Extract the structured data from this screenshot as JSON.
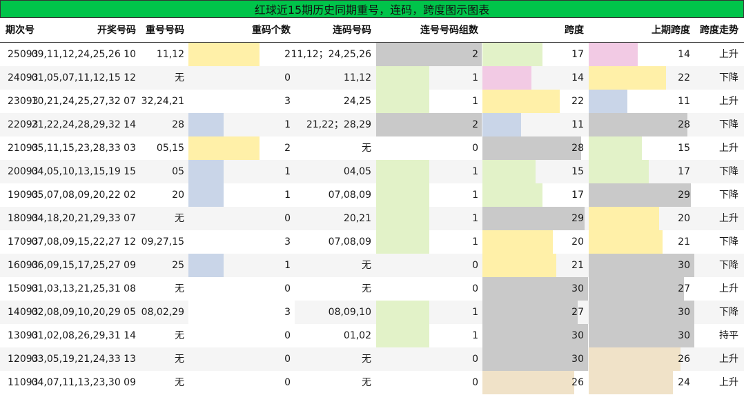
{
  "title": "红球近15期历史同期重号，连码，跨度图示图表",
  "headers": {
    "period": "期次号",
    "draw": "开奖号码",
    "repeat_nums": "重号号码",
    "repeat_count": "重码个数",
    "consec_nums": "连码号码",
    "consec_groups": "连号号码组数",
    "span": "跨度",
    "prev_span": "上期跨度",
    "trend": "跨度走势"
  },
  "colors": {
    "title_bg": "#00c44a",
    "c0": "#c9c9c9",
    "c1": "#c9d5e8",
    "c2": "#fff0a8",
    "c3": "#ffffff",
    "span_14": "#f2cae4",
    "span_17": "#e2f2c8",
    "span_11": "#c9d5e8",
    "span_22": "#fff0a8",
    "span_28": "#c9c9c9",
    "span_15": "#e2f2c8",
    "span_29": "#c9c9c9",
    "span_20": "#fff0a8",
    "span_21": "#fff0a8",
    "span_30": "#c9c9c9",
    "span_27": "#c9c9c9",
    "span_26": "#f0e2c8",
    "span_24": "#f0e2c8"
  },
  "rows": [
    {
      "period": "25093",
      "draw": "09,11,12,24,25,26 10",
      "repeat_nums": "11,12",
      "repeat_count": 2,
      "consec_nums": "11,12；24,25,26",
      "consec_groups": 2,
      "span": 17,
      "prev_span": 14,
      "trend": "上升"
    },
    {
      "period": "24093",
      "draw": "01,05,07,11,12,15 12",
      "repeat_nums": "无",
      "repeat_count": 0,
      "consec_nums": "11,12",
      "consec_groups": 1,
      "span": 14,
      "prev_span": 22,
      "trend": "下降"
    },
    {
      "period": "23093",
      "draw": "10,21,24,25,27,32 07",
      "repeat_nums": "32,24,21",
      "repeat_count": 3,
      "consec_nums": "24,25",
      "consec_groups": 1,
      "span": 22,
      "prev_span": 11,
      "trend": "上升"
    },
    {
      "period": "22093",
      "draw": "21,22,24,28,29,32 14",
      "repeat_nums": "28",
      "repeat_count": 1,
      "consec_nums": "21,22；28,29",
      "consec_groups": 2,
      "span": 11,
      "prev_span": 28,
      "trend": "下降"
    },
    {
      "period": "21093",
      "draw": "05,11,15,23,28,33 03",
      "repeat_nums": "05,15",
      "repeat_count": 2,
      "consec_nums": "无",
      "consec_groups": 0,
      "span": 28,
      "prev_span": 15,
      "trend": "上升"
    },
    {
      "period": "20093",
      "draw": "04,05,10,13,15,19 15",
      "repeat_nums": "05",
      "repeat_count": 1,
      "consec_nums": "04,05",
      "consec_groups": 1,
      "span": 15,
      "prev_span": 17,
      "trend": "下降"
    },
    {
      "period": "19093",
      "draw": "05,07,08,09,20,22 02",
      "repeat_nums": "20",
      "repeat_count": 1,
      "consec_nums": "07,08,09",
      "consec_groups": 1,
      "span": 17,
      "prev_span": 29,
      "trend": "下降"
    },
    {
      "period": "18093",
      "draw": "04,18,20,21,29,33 07",
      "repeat_nums": "无",
      "repeat_count": 0,
      "consec_nums": "20,21",
      "consec_groups": 1,
      "span": 29,
      "prev_span": 20,
      "trend": "上升"
    },
    {
      "period": "17093",
      "draw": "07,08,09,15,22,27 12",
      "repeat_nums": "09,27,15",
      "repeat_count": 3,
      "consec_nums": "07,08,09",
      "consec_groups": 1,
      "span": 20,
      "prev_span": 21,
      "trend": "下降"
    },
    {
      "period": "16093",
      "draw": "06,09,15,17,25,27 09",
      "repeat_nums": "25",
      "repeat_count": 1,
      "consec_nums": "无",
      "consec_groups": 0,
      "span": 21,
      "prev_span": 30,
      "trend": "下降"
    },
    {
      "period": "15093",
      "draw": "01,03,13,21,25,31 08",
      "repeat_nums": "无",
      "repeat_count": 0,
      "consec_nums": "无",
      "consec_groups": 0,
      "span": 30,
      "prev_span": 27,
      "trend": "上升"
    },
    {
      "period": "14093",
      "draw": "02,08,09,10,20,29 05",
      "repeat_nums": "08,02,29",
      "repeat_count": 3,
      "consec_nums": "08,09,10",
      "consec_groups": 1,
      "span": 27,
      "prev_span": 30,
      "trend": "下降"
    },
    {
      "period": "13093",
      "draw": "01,02,08,26,29,31 14",
      "repeat_nums": "无",
      "repeat_count": 0,
      "consec_nums": "01,02",
      "consec_groups": 1,
      "span": 30,
      "prev_span": 30,
      "trend": "持平"
    },
    {
      "period": "12093",
      "draw": "03,05,19,21,24,33 13",
      "repeat_nums": "无",
      "repeat_count": 0,
      "consec_nums": "无",
      "consec_groups": 0,
      "span": 30,
      "prev_span": 26,
      "trend": "上升"
    },
    {
      "period": "11093",
      "draw": "04,07,11,13,23,30 09",
      "repeat_nums": "无",
      "repeat_count": 0,
      "consec_nums": "无",
      "consec_groups": 0,
      "span": 26,
      "prev_span": 24,
      "trend": "上升"
    }
  ]
}
